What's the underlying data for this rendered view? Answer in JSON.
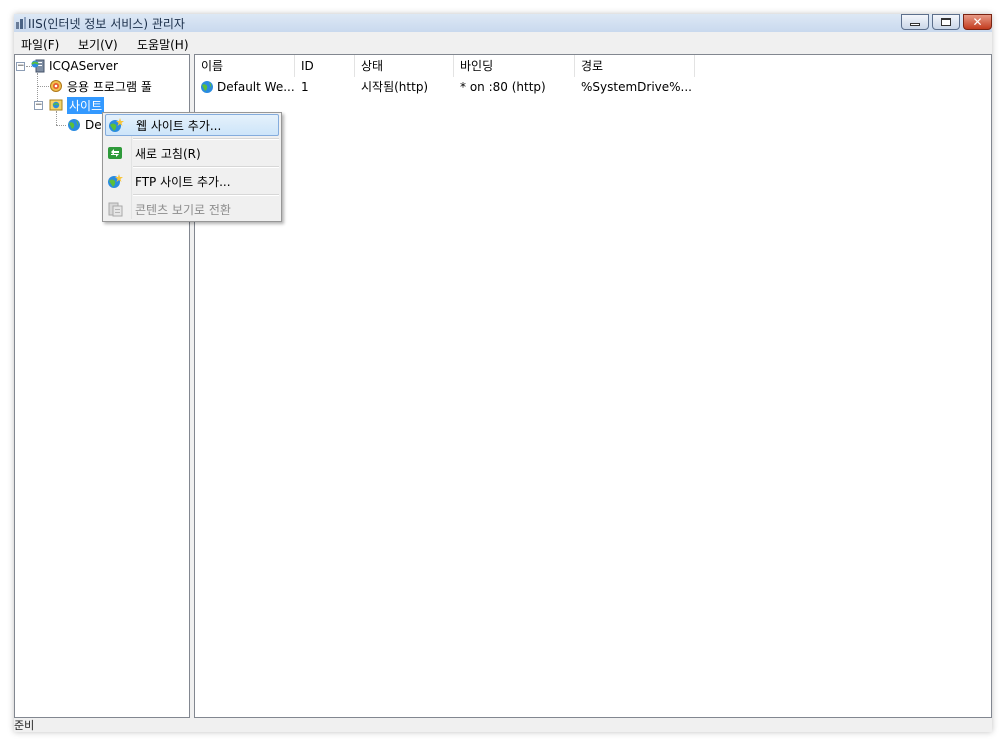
{
  "window": {
    "title": "IIS(인터넷 정보 서비스) 관리자",
    "close_glyph": "✕"
  },
  "menu": {
    "items": [
      "파일(F)",
      "보기(V)",
      "도움말(H)"
    ]
  },
  "tree": {
    "server": {
      "label": "ICQAServer",
      "toggle": "−",
      "icon": "server-icon"
    },
    "app_pools": {
      "label": "응용 프로그램 풀",
      "icon": "app-pool-icon"
    },
    "sites": {
      "label": "사이트",
      "toggle": "−",
      "icon": "sites-folder-icon"
    },
    "default_site": {
      "label": "Default Web Site",
      "visible_label": "De",
      "icon": "globe-icon"
    }
  },
  "list": {
    "columns": [
      "이름",
      "ID",
      "상태",
      "바인딩",
      "경로"
    ],
    "rows": [
      {
        "name": "Default We...",
        "id": "1",
        "status": "시작됨(http)",
        "binding": "* on :80 (http)",
        "path": "%SystemDrive%..."
      }
    ]
  },
  "context_menu": {
    "items": [
      {
        "label": "웹 사이트 추가...",
        "icon": "add-website-icon",
        "highlighted": true,
        "enabled": true
      },
      {
        "label": "새로 고침(R)",
        "icon": "refresh-icon",
        "highlighted": false,
        "enabled": true
      },
      {
        "label": "FTP 사이트 추가...",
        "icon": "add-ftp-site-icon",
        "highlighted": false,
        "enabled": true
      },
      {
        "label": "콘텐츠 보기로 전환",
        "icon": "content-view-icon",
        "highlighted": false,
        "enabled": false
      }
    ]
  },
  "status": {
    "text": "준비"
  },
  "colors": {
    "selection": "#3399ff",
    "menu_highlight": "#cde5fa"
  }
}
